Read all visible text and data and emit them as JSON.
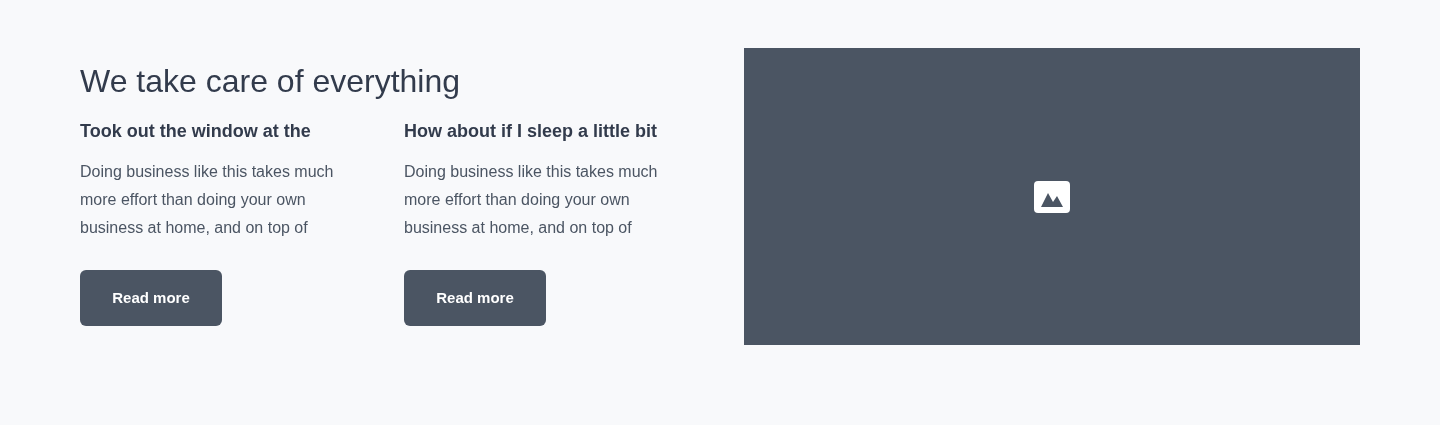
{
  "heading": "We take care of everything",
  "features": [
    {
      "title": "Took out the window at the",
      "text": "Doing business like this takes much more effort than doing your own business at home, and on top of",
      "button": "Read more"
    },
    {
      "title": "How about if I sleep a little bit",
      "text": "Doing business like this takes much more effort than doing your own business at home, and on top of",
      "button": "Read more"
    }
  ]
}
